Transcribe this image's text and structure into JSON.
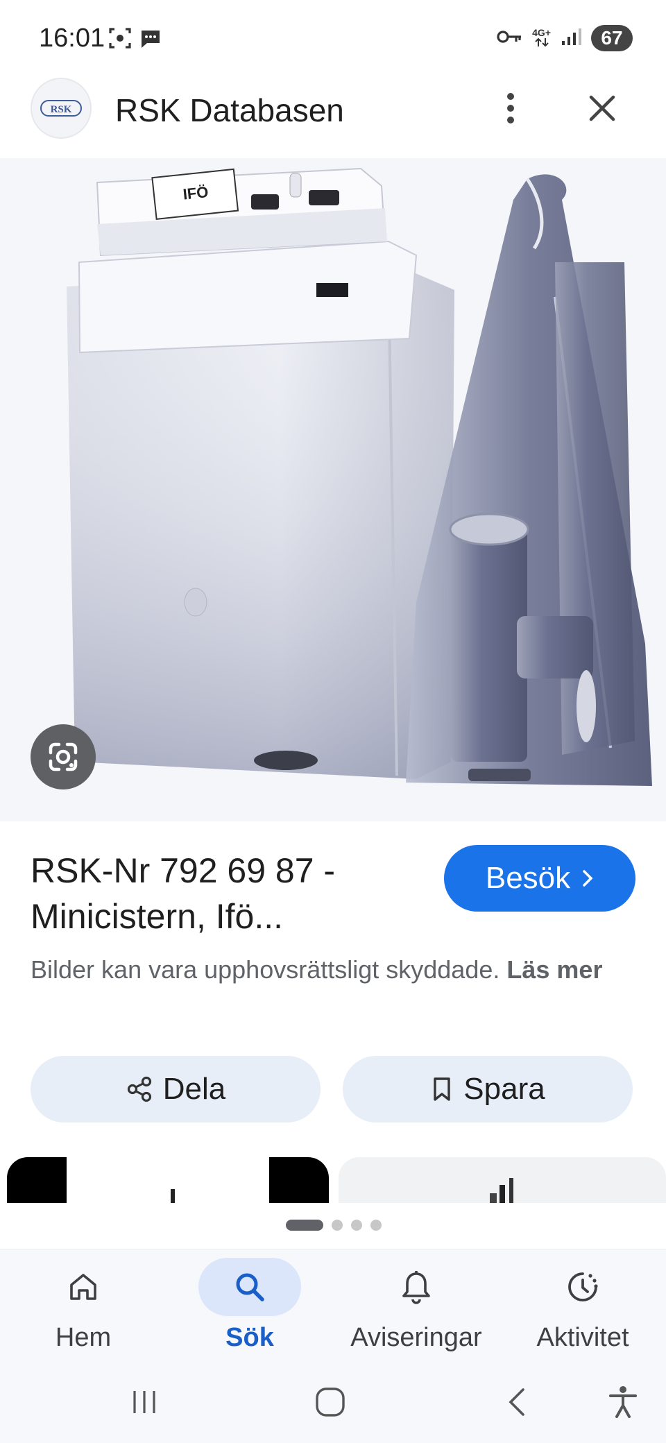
{
  "status_bar": {
    "time": "16:01",
    "network": "4G+",
    "battery": "67",
    "icons": [
      "screenshot-icon",
      "chat-bubble-icon",
      "key-icon",
      "signal-icon"
    ]
  },
  "header": {
    "logo_text": "RSK",
    "site_name": "RSK Databasen",
    "more_icon": "more-vertical-icon",
    "close_icon": "close-icon"
  },
  "image": {
    "label_text": "IFÖ",
    "lens_icon": "google-lens-icon"
  },
  "result": {
    "title": "RSK-Nr 792 69 87 - Minicistern, Ifö...",
    "visit_label": "Besök",
    "visit_icon": "chevron-right-icon",
    "copyright_text": "Bilder kan vara upphovsrättsligt skyddade.",
    "read_more": "Läs mer"
  },
  "actions": {
    "share_label": "Dela",
    "share_icon": "share-icon",
    "save_label": "Spara",
    "save_icon": "bookmark-icon"
  },
  "carousel": {
    "total_pages": 4,
    "active_page": 1
  },
  "bottom_nav": {
    "items": [
      {
        "label": "Hem",
        "icon": "home-icon"
      },
      {
        "label": "Sök",
        "icon": "search-icon",
        "active": true
      },
      {
        "label": "Aviseringar",
        "icon": "bell-icon"
      },
      {
        "label": "Aktivitet",
        "icon": "activity-icon"
      }
    ]
  },
  "system_nav": {
    "items": [
      "recent-apps-icon",
      "home-circle-icon",
      "back-icon",
      "accessibility-icon"
    ]
  },
  "colors": {
    "accent": "#1a73e8",
    "action_bg": "#e8eef8",
    "nav_active_bg": "#dbe6fb",
    "nav_active_text": "#1a5fc8"
  }
}
